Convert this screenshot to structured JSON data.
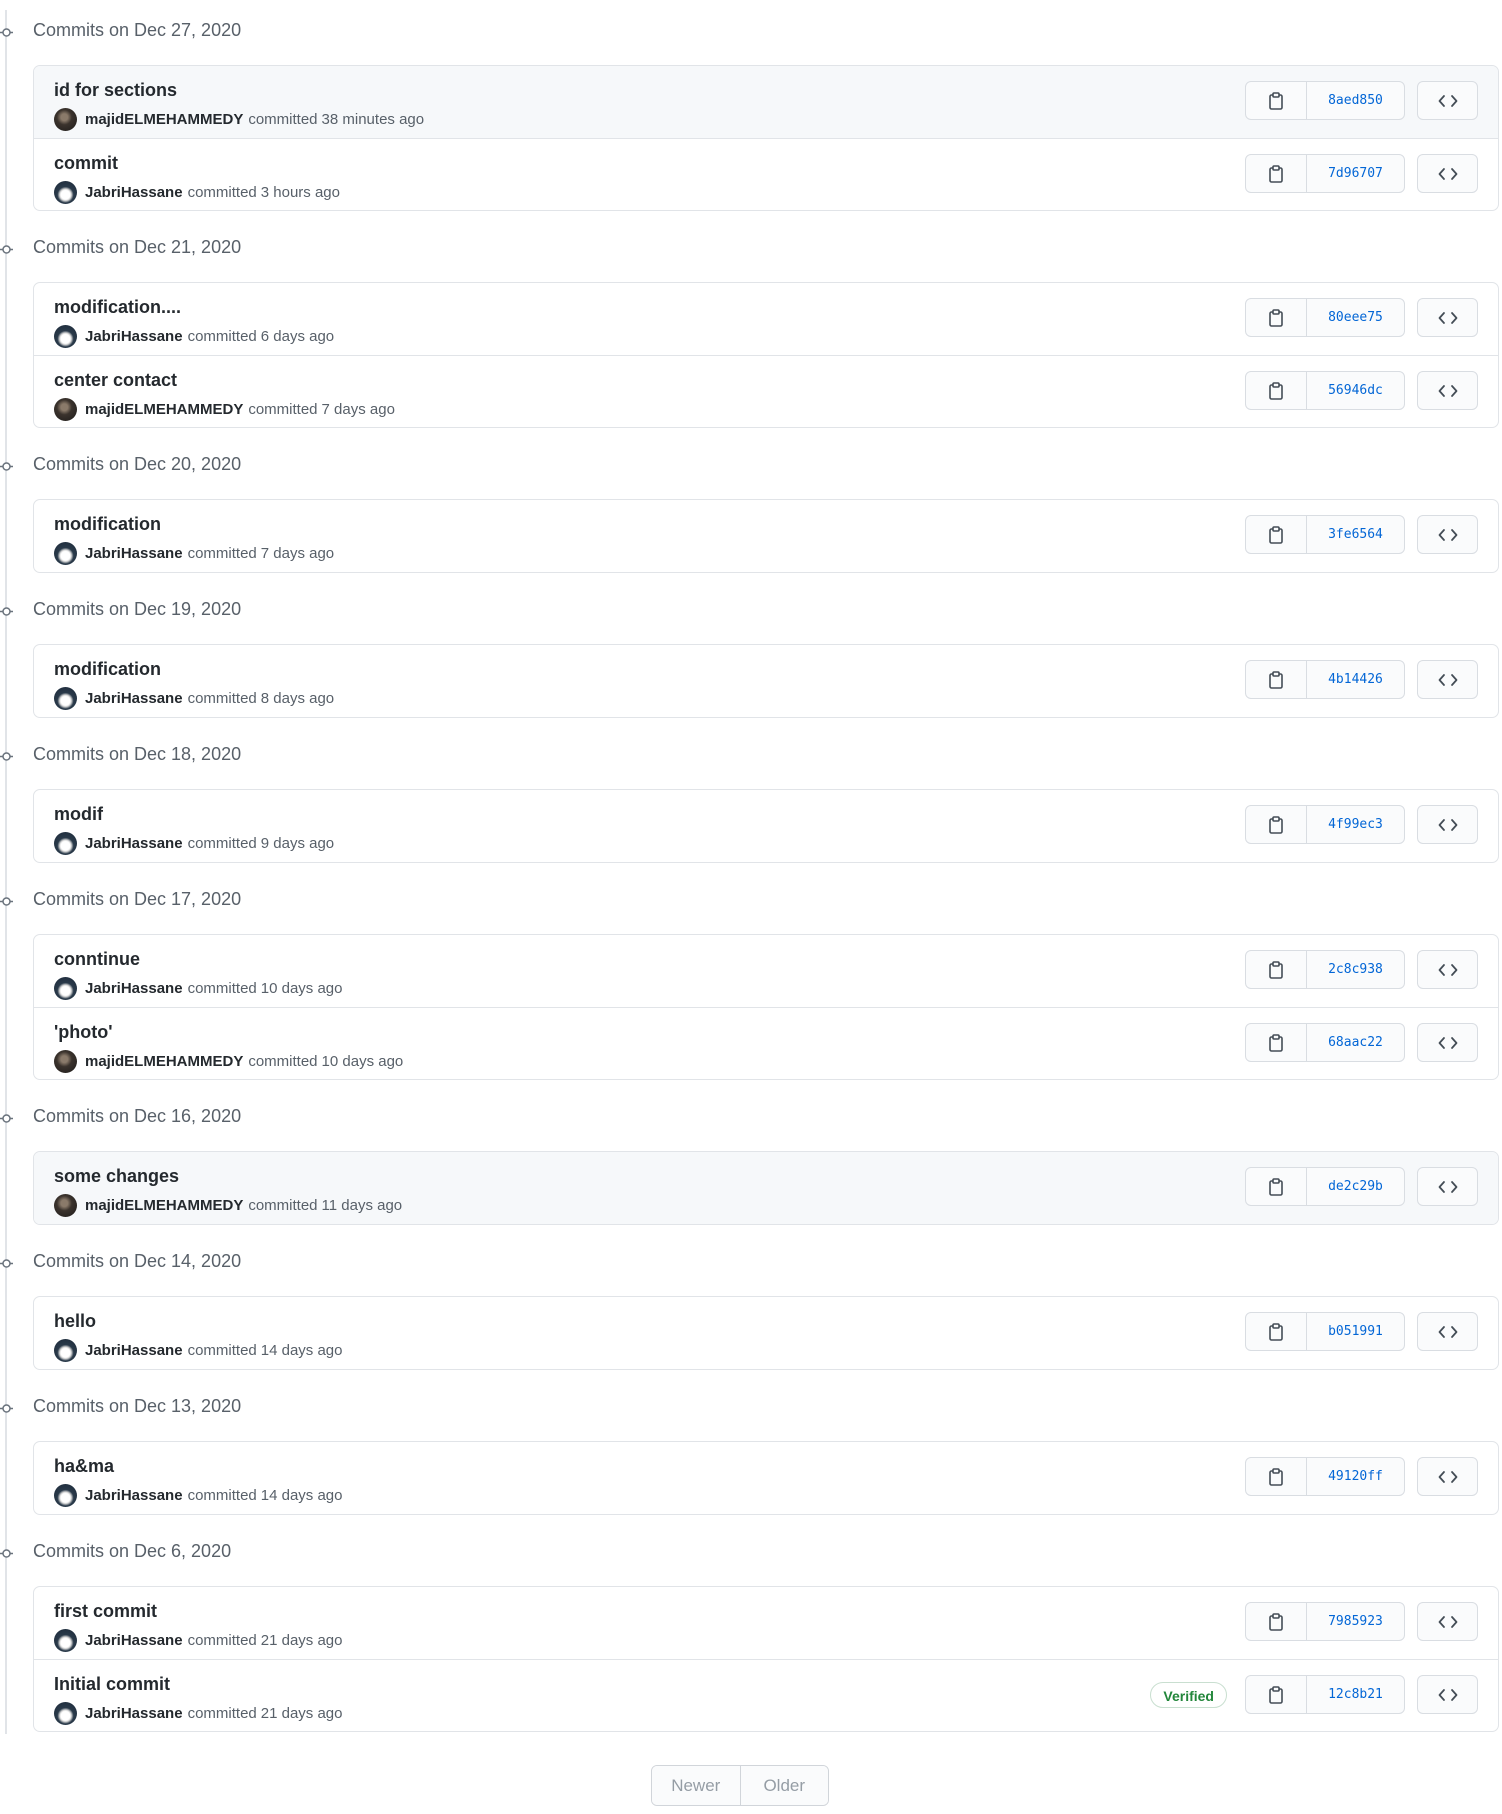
{
  "groups": [
    {
      "date": "Commits on Dec 27, 2020",
      "commits": [
        {
          "message": "id for sections",
          "author": "majidELMEHAMMEDY",
          "action": "committed",
          "time": "38 minutes ago",
          "sha": "8aed850",
          "avatar": "dark",
          "highlight": true
        },
        {
          "message": "commit",
          "author": "JabriHassane",
          "action": "committed",
          "time": "3 hours ago",
          "sha": "7d96707",
          "avatar": "light"
        }
      ]
    },
    {
      "date": "Commits on Dec 21, 2020",
      "commits": [
        {
          "message": "modification....",
          "author": "JabriHassane",
          "action": "committed",
          "time": "6 days ago",
          "sha": "80eee75",
          "avatar": "light"
        },
        {
          "message": "center contact",
          "author": "majidELMEHAMMEDY",
          "action": "committed",
          "time": "7 days ago",
          "sha": "56946dc",
          "avatar": "dark"
        }
      ]
    },
    {
      "date": "Commits on Dec 20, 2020",
      "commits": [
        {
          "message": "modification",
          "author": "JabriHassane",
          "action": "committed",
          "time": "7 days ago",
          "sha": "3fe6564",
          "avatar": "light"
        }
      ]
    },
    {
      "date": "Commits on Dec 19, 2020",
      "commits": [
        {
          "message": "modification",
          "author": "JabriHassane",
          "action": "committed",
          "time": "8 days ago",
          "sha": "4b14426",
          "avatar": "light"
        }
      ]
    },
    {
      "date": "Commits on Dec 18, 2020",
      "commits": [
        {
          "message": "modif",
          "author": "JabriHassane",
          "action": "committed",
          "time": "9 days ago",
          "sha": "4f99ec3",
          "avatar": "light"
        }
      ]
    },
    {
      "date": "Commits on Dec 17, 2020",
      "commits": [
        {
          "message": "conntinue",
          "author": "JabriHassane",
          "action": "committed",
          "time": "10 days ago",
          "sha": "2c8c938",
          "avatar": "light"
        },
        {
          "message": "'photo'",
          "author": "majidELMEHAMMEDY",
          "action": "committed",
          "time": "10 days ago",
          "sha": "68aac22",
          "avatar": "dark"
        }
      ]
    },
    {
      "date": "Commits on Dec 16, 2020",
      "commits": [
        {
          "message": "some changes",
          "author": "majidELMEHAMMEDY",
          "action": "committed",
          "time": "11 days ago",
          "sha": "de2c29b",
          "avatar": "dark",
          "highlight": true
        }
      ]
    },
    {
      "date": "Commits on Dec 14, 2020",
      "commits": [
        {
          "message": "hello",
          "author": "JabriHassane",
          "action": "committed",
          "time": "14 days ago",
          "sha": "b051991",
          "avatar": "light"
        }
      ]
    },
    {
      "date": "Commits on Dec 13, 2020",
      "commits": [
        {
          "message": "ha&ma",
          "author": "JabriHassane",
          "action": "committed",
          "time": "14 days ago",
          "sha": "49120ff",
          "avatar": "light"
        }
      ]
    },
    {
      "date": "Commits on Dec 6, 2020",
      "commits": [
        {
          "message": "first commit",
          "author": "JabriHassane",
          "action": "committed",
          "time": "21 days ago",
          "sha": "7985923",
          "avatar": "light"
        },
        {
          "message": "Initial commit",
          "author": "JabriHassane",
          "action": "committed",
          "time": "21 days ago",
          "sha": "12c8b21",
          "avatar": "light",
          "verified": "Verified"
        }
      ]
    }
  ],
  "pagination": {
    "newer": "Newer",
    "older": "Older"
  },
  "icons": {
    "copy": "clipboard-icon",
    "browse": "code-icon",
    "timeline": "commit-dot-icon"
  },
  "colors": {
    "link": "#0366d6",
    "verified": "#22863a",
    "border": "#e1e4e8",
    "muted": "#586069"
  }
}
